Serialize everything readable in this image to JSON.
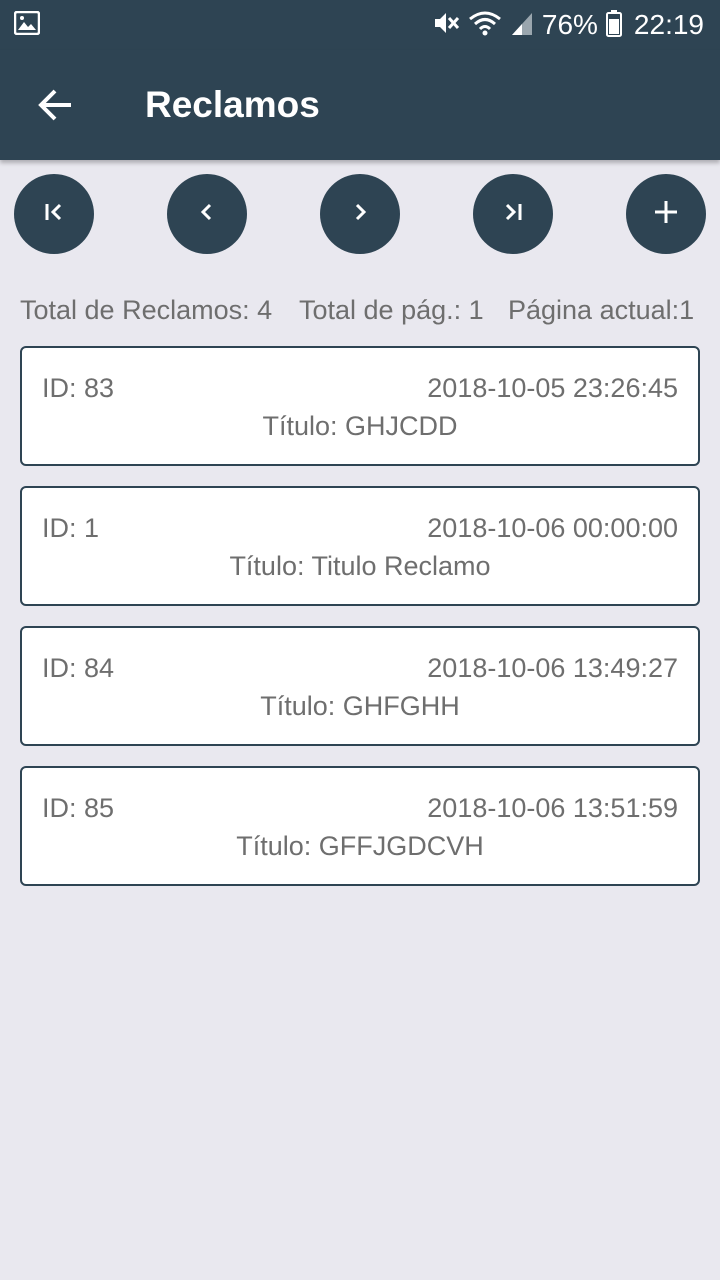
{
  "status_bar": {
    "battery": "76%",
    "time": "22:19"
  },
  "app_bar": {
    "title": "Reclamos"
  },
  "pagination": {
    "buttons": [
      "first-page",
      "previous-page",
      "next-page",
      "last-page",
      "add"
    ]
  },
  "summary": {
    "total_reclamos": "Total de Reclamos: 4",
    "total_pag": "Total de pág.: 1",
    "pagina_actual": "Página actual:1"
  },
  "reclamos": [
    {
      "id": "ID: 83",
      "date": "2018-10-05 23:26:45",
      "titulo": "Título: GHJCDD"
    },
    {
      "id": "ID: 1",
      "date": "2018-10-06 00:00:00",
      "titulo": "Título: Titulo Reclamo"
    },
    {
      "id": "ID: 84",
      "date": "2018-10-06 13:49:27",
      "titulo": "Título: GHFGHH"
    },
    {
      "id": "ID: 85",
      "date": "2018-10-06 13:51:59",
      "titulo": "Título: GFFJGDCVH"
    }
  ],
  "colors": {
    "primary": "#2E4453",
    "background": "#E9E8EF",
    "card": "#FFFFFF",
    "text_secondary": "#6E6E6E"
  }
}
